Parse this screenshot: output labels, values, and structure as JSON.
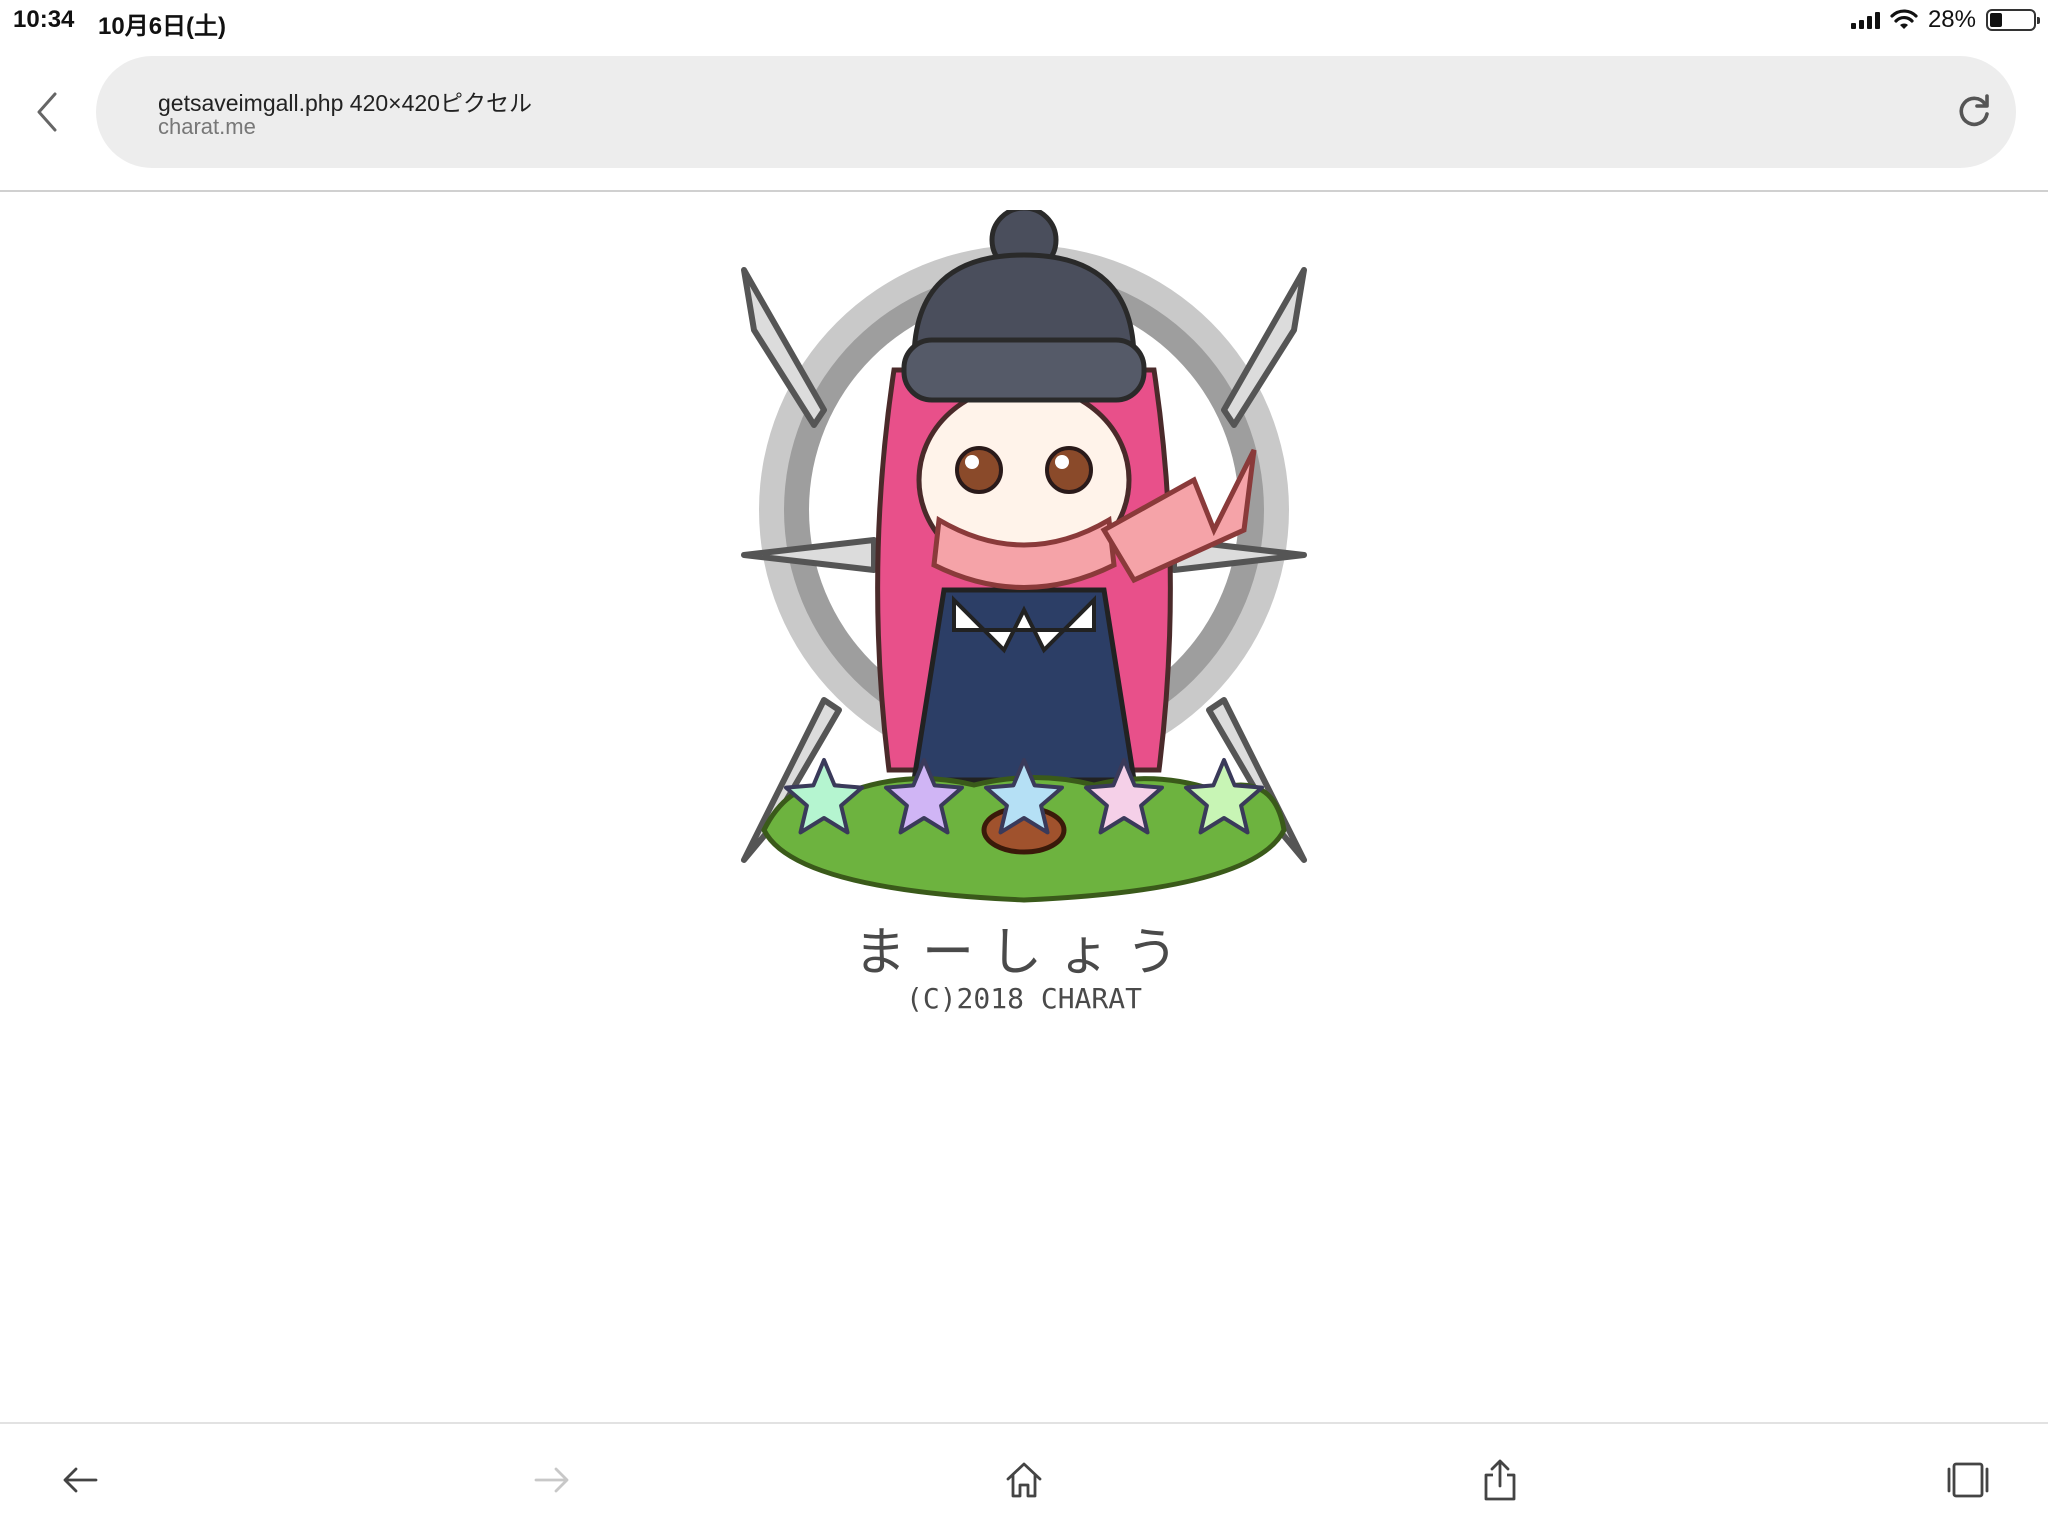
{
  "status_bar": {
    "time": "10:34",
    "date": "10月6日(土)",
    "battery_percent": "28%",
    "battery_level": 0.28
  },
  "address_bar": {
    "title": "getsaveimgall.php 420×420ピクセル",
    "host": "charat.me"
  },
  "image": {
    "name_text": "まーしょう",
    "copyright_text": "(C)2018 CHARAT",
    "stars": 5,
    "colors": {
      "hat": "#4a4e5c",
      "hair": "#e8508a",
      "scarf": "#f5a3a8",
      "coat": "#2c3e66",
      "grass": "#6db33f",
      "emblem": "#bdbdbd"
    }
  },
  "toolbar": {
    "icons": [
      "back-arrow-icon",
      "forward-arrow-icon",
      "home-icon",
      "share-icon",
      "tabs-icon"
    ]
  }
}
